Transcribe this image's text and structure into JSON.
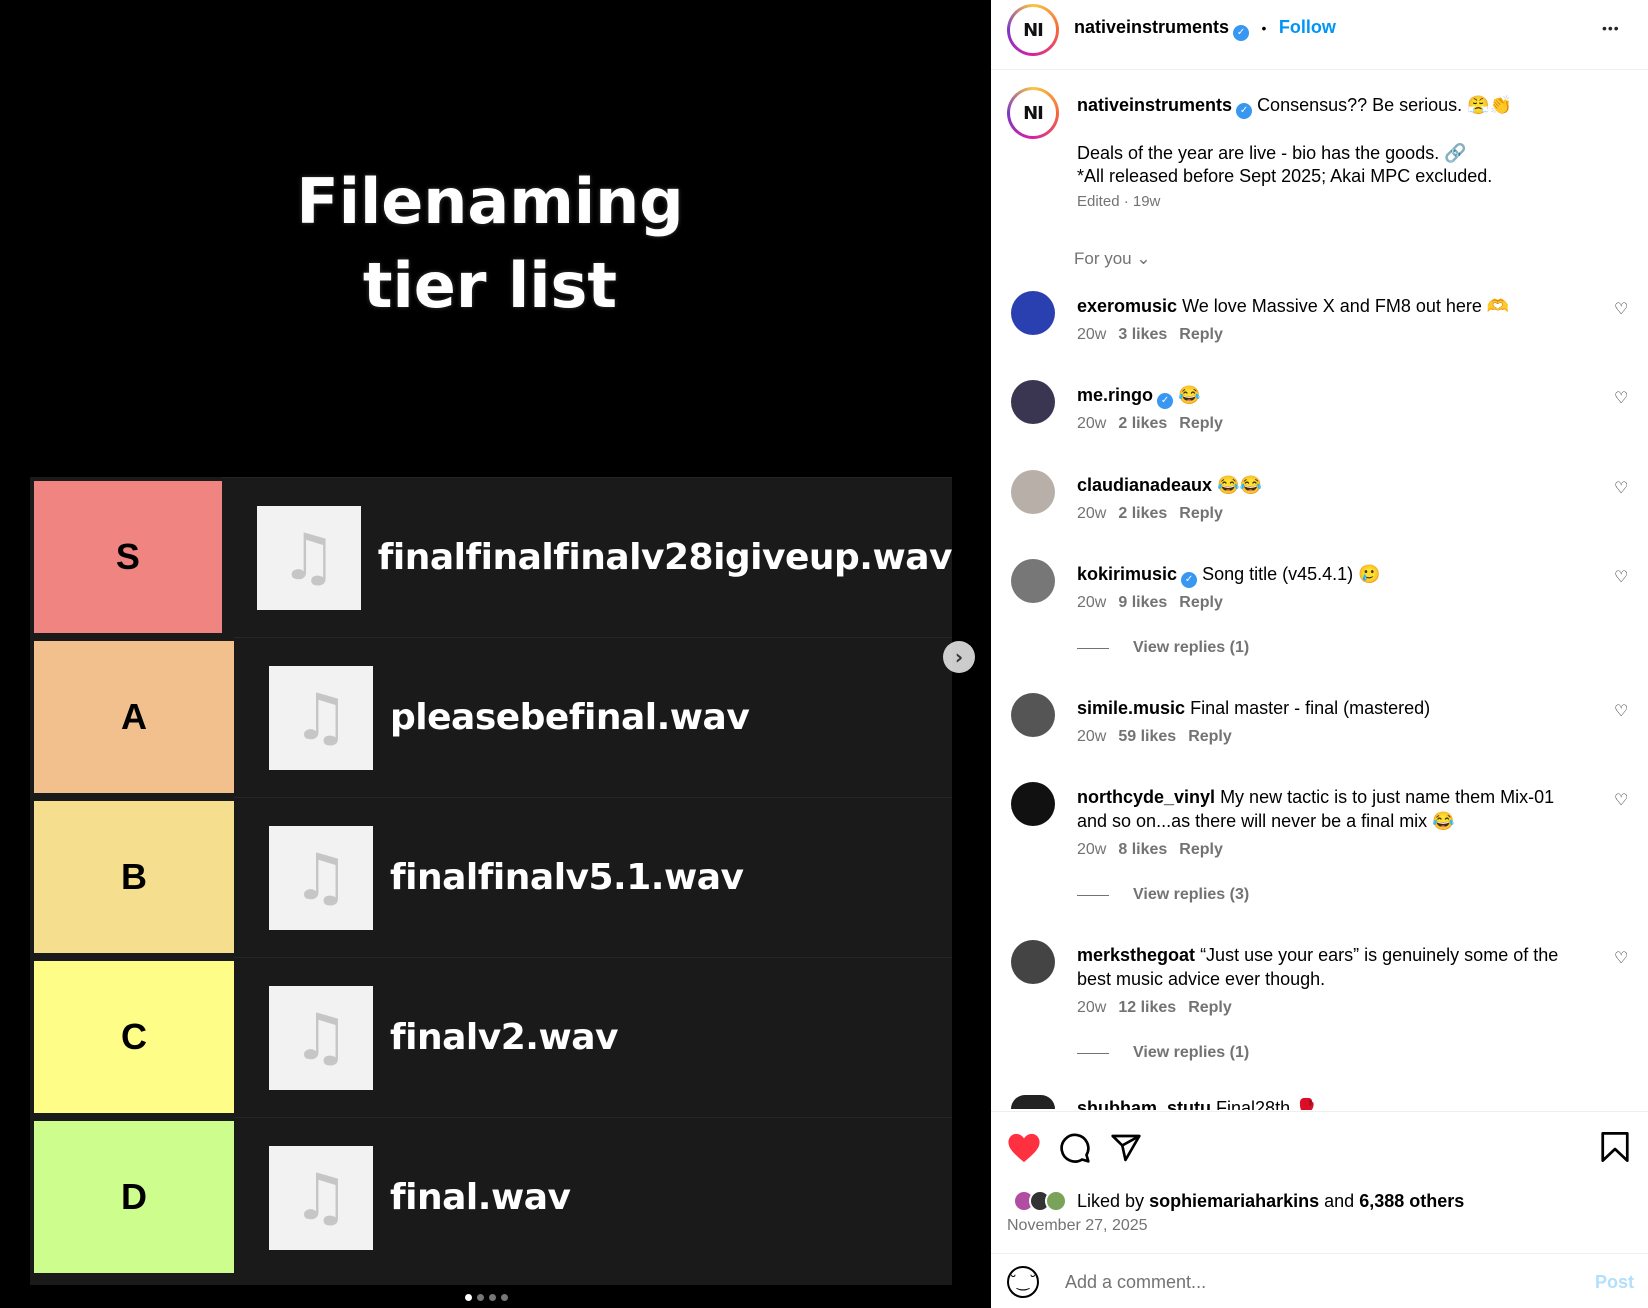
{
  "media": {
    "title_line1": "Filenaming",
    "title_line2": "tier list",
    "tiers": [
      {
        "label": "S",
        "color": "#ef8480",
        "file": "finalfinalfinalv28igiveup.wav"
      },
      {
        "label": "A",
        "color": "#f1c08c",
        "file": "pleasebefinal.wav"
      },
      {
        "label": "B",
        "color": "#f6de8f",
        "file": "finalfinalv5.1.wav"
      },
      {
        "label": "C",
        "color": "#fdfd87",
        "file": "finalv2.wav"
      },
      {
        "label": "D",
        "color": "#cdfd8c",
        "file": "final.wav"
      }
    ],
    "music_note": "♫",
    "next_icon": "›",
    "carousel_count": 4,
    "carousel_active": 1
  },
  "header": {
    "avatar_text": "NI",
    "username": "nativeinstruments",
    "separator": "•",
    "follow": "Follow",
    "more": "•••"
  },
  "caption": {
    "username": "nativeinstruments",
    "text1": "Consensus?? Be serious. 😤👏",
    "text2": "Deals of the year are live - bio has the goods. 🔗",
    "text3": "*All released before Sept 2025; Akai MPC excluded.",
    "meta": "Edited · 19w"
  },
  "filter": {
    "label": "For you",
    "chevron": "⌄"
  },
  "comments": [
    {
      "user": "exeromusic",
      "verified": false,
      "text": "We love Massive X and FM8 out here 🫶",
      "time": "20w",
      "likes": "3 likes",
      "reply": "Reply"
    },
    {
      "user": "me.ringo",
      "verified": true,
      "text": "😂",
      "time": "20w",
      "likes": "2 likes",
      "reply": "Reply"
    },
    {
      "user": "claudianadeaux",
      "verified": false,
      "text": "😂😂",
      "time": "20w",
      "likes": "2 likes",
      "reply": "Reply"
    },
    {
      "user": "kokirimusic",
      "verified": true,
      "text": "Song title (v45.4.1) 🥲",
      "time": "20w",
      "likes": "9 likes",
      "reply": "Reply",
      "view_replies": "View replies (1)"
    },
    {
      "user": "simile.music",
      "verified": false,
      "text": "Final master - final (mastered)",
      "time": "20w",
      "likes": "59 likes",
      "reply": "Reply"
    },
    {
      "user": "northcyde_vinyl",
      "verified": false,
      "text": "My new tactic is to just name them Mix-01",
      "text_line2": "and so on...as there will never be a final mix 😂",
      "time": "20w",
      "likes": "8 likes",
      "reply": "Reply",
      "view_replies": "View replies (3)"
    },
    {
      "user": "merksthegoat",
      "verified": false,
      "text": "“Just use your ears” is genuinely some of the",
      "text_line2": "best music advice ever though.",
      "time": "20w",
      "likes": "12 likes",
      "reply": "Reply",
      "view_replies": "View replies (1)"
    },
    {
      "user": "shubham_stutu",
      "verified": false,
      "text": "Final28th 🥊"
    }
  ],
  "actions": {
    "like_icon": "heart-filled-icon",
    "comment_icon": "comment-icon",
    "share_icon": "share-icon",
    "save_icon": "bookmark-icon",
    "liked_by_prefix": "Liked by",
    "liked_by_user": "sophiemariaharkins",
    "liked_by_and": "and",
    "liked_by_others": "6,388 others",
    "date": "November 27, 2025"
  },
  "add_comment": {
    "placeholder": "Add a comment...",
    "post": "Post",
    "emoji_icon": "☺"
  },
  "colors": {
    "accent": "#0095f6",
    "like": "#ff3040",
    "verified": "#3897f0"
  }
}
